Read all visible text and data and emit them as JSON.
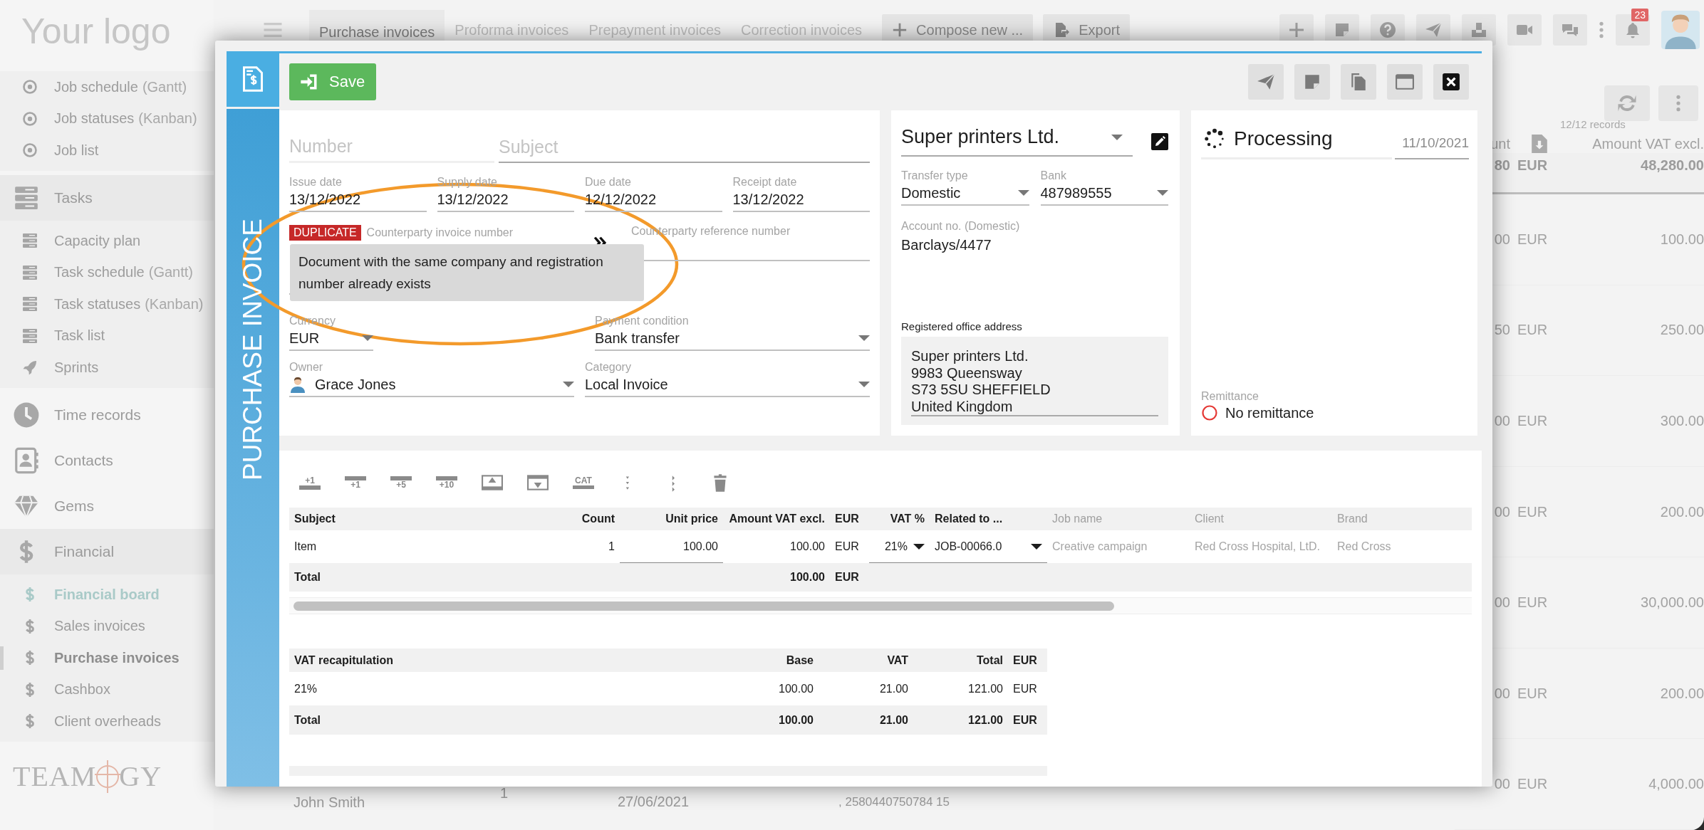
{
  "sidebar": {
    "logo": "Your logo",
    "sections": [
      {
        "items": [
          {
            "label": "Job schedule",
            "note": "(Gantt)",
            "accent": false,
            "selected": false
          },
          {
            "label": "Job statuses",
            "note": "(Kanban)",
            "accent": false,
            "selected": false
          },
          {
            "label": "Job list",
            "accent": false,
            "selected": false
          }
        ]
      },
      {
        "header": "Tasks",
        "items": [
          {
            "label": "Capacity plan",
            "accent": false,
            "selected": false
          },
          {
            "label": "Task schedule",
            "note": "(Gantt)",
            "accent": false,
            "selected": false
          },
          {
            "label": "Task statuses",
            "note": "(Kanban)",
            "accent": false,
            "selected": false
          },
          {
            "label": "Task list",
            "accent": false,
            "selected": false
          },
          {
            "label": "Sprints",
            "accent": false,
            "selected": false
          }
        ]
      },
      {
        "header": "Time records"
      },
      {
        "header": "Contacts"
      },
      {
        "header": "Gems"
      },
      {
        "header": "Financial",
        "items": [
          {
            "label": "Financial board",
            "accent": true,
            "selected": false
          },
          {
            "label": "Sales invoices",
            "accent": false,
            "selected": false
          },
          {
            "label": "Purchase invoices",
            "accent": false,
            "selected": true
          },
          {
            "label": "Cashbox",
            "accent": false,
            "selected": false
          },
          {
            "label": "Client overheads",
            "accent": false,
            "selected": false
          }
        ]
      }
    ],
    "brand_left": "TEAM",
    "brand_right": "GY"
  },
  "topbar": {
    "tabs": [
      {
        "label": "Purchase invoices",
        "selected": true
      },
      {
        "label": "Proforma invoices",
        "selected": false
      },
      {
        "label": "Prepayment invoices",
        "selected": false
      },
      {
        "label": "Correction invoices",
        "selected": false
      }
    ],
    "buttons": [
      {
        "label": "Compose new ...",
        "kind": "compose"
      },
      {
        "label": "Export",
        "kind": "export"
      }
    ],
    "notifications": "23"
  },
  "background_table": {
    "records": "12/12 records",
    "columns": [
      {
        "kind": "text",
        "label": "unt"
      },
      {
        "kind": "download"
      },
      {
        "kind": "text",
        "label": "Amount VAT excl."
      }
    ],
    "totals": [
      "80",
      "EUR",
      "48,280.00"
    ],
    "rows": [
      [
        "00",
        "EUR",
        "100.00"
      ],
      [
        "50",
        "EUR",
        "250.00"
      ],
      [
        "00",
        "EUR",
        "300.00"
      ],
      [
        "00",
        "EUR",
        "200.00"
      ],
      [
        "00",
        "EUR",
        "30,000.00"
      ],
      [
        "00",
        "EUR",
        "200.00"
      ],
      [
        "00",
        "EUR",
        "4,000.00"
      ]
    ]
  },
  "background_row": {
    "owner": "John Smith",
    "count": "1",
    "date": "27/06/2021",
    "number": ", 2580440750784 15"
  },
  "modal": {
    "title": "PURCHASE INVOICE",
    "save": "Save",
    "form": {
      "number": {
        "placeholder": "Number"
      },
      "subject": {
        "placeholder": "Subject"
      },
      "dates": [
        {
          "label": "Issue date",
          "value": "13/12/2022"
        },
        {
          "label": "Supply date",
          "value": "13/12/2022"
        },
        {
          "label": "Due date",
          "value": "12/12/2022"
        },
        {
          "label": "Receipt date",
          "value": "13/12/2022"
        }
      ],
      "counterparty": {
        "badge": "DUPLICATE",
        "label": "Counterparty invoice number"
      },
      "reference": {
        "label": "Counterparty reference number"
      },
      "tooltip": "Document with the same company and registration number already exists",
      "currency": {
        "label": "Currency",
        "value": "EUR"
      },
      "payment": {
        "label": "Payment condition",
        "value": "Bank transfer"
      },
      "owner": {
        "label": "Owner",
        "value": "Grace Jones"
      },
      "category": {
        "label": "Category",
        "value": "Local Invoice"
      }
    },
    "company": {
      "name": "Super printers Ltd.",
      "transfer": {
        "label": "Transfer type",
        "value": "Domestic"
      },
      "bank": {
        "label": "Bank",
        "value": "487989555"
      },
      "account": {
        "label": "Account no. (Domestic)",
        "value": "Barclays/4477"
      },
      "address": {
        "label": "Registered office address",
        "lines": [
          "Super printers Ltd.",
          "9983 Queensway",
          "S73 5SU SHEFFIELD",
          "United Kingdom"
        ]
      }
    },
    "status": {
      "label": "Processing",
      "date": "11/10/2021",
      "remittance": {
        "label": "Remittance",
        "value": "No remittance"
      }
    },
    "items": {
      "tools": [
        {
          "kind": "add-above",
          "label": "+1"
        },
        {
          "kind": "add-below",
          "label": "+1"
        },
        {
          "kind": "add-below",
          "label": "+5"
        },
        {
          "kind": "add-below",
          "label": "+10"
        },
        {
          "kind": "insert-above"
        },
        {
          "kind": "insert-below"
        },
        {
          "kind": "category",
          "label": "CAT"
        },
        {
          "kind": "expand"
        },
        {
          "kind": "collapse"
        },
        {
          "kind": "delete"
        }
      ],
      "columns": [
        {
          "label": "Subject",
          "disabled": false
        },
        {
          "label": "Count",
          "disabled": false
        },
        {
          "label": "Unit price",
          "disabled": false
        },
        {
          "label": "Amount VAT excl.",
          "disabled": false
        },
        {
          "label": "EUR",
          "disabled": false
        },
        {
          "label": "VAT %",
          "disabled": false
        },
        {
          "label": "Related to ...",
          "disabled": false
        },
        {
          "label": "Job name",
          "disabled": true
        },
        {
          "label": "Client",
          "disabled": true
        },
        {
          "label": "Brand",
          "disabled": true
        }
      ],
      "rows": [
        [
          "Item",
          "1",
          "100.00",
          "100.00",
          "EUR",
          "21%",
          "JOB-00066.0",
          "Creative campaign",
          "Red Cross Hospital, LtD.",
          "Red Cross"
        ]
      ],
      "total": {
        "label": "Total",
        "amount": "100.00",
        "currency": "EUR"
      }
    },
    "vat": {
      "columns": [
        "VAT recapitulation",
        "Base",
        "VAT",
        "Total",
        "EUR"
      ],
      "rows": [
        [
          "21%",
          "100.00",
          "21.00",
          "121.00",
          "EUR"
        ]
      ],
      "total": [
        "Total",
        "100.00",
        "21.00",
        "121.00",
        "EUR"
      ]
    }
  }
}
